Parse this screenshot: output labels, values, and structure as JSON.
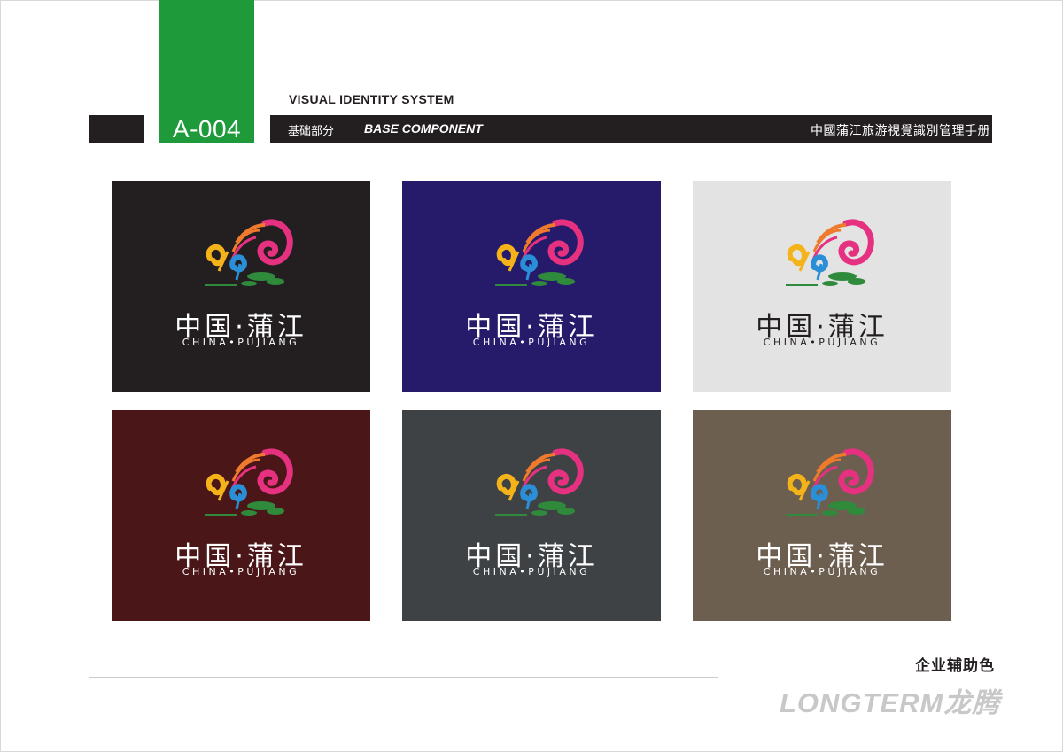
{
  "header": {
    "code": "A-004",
    "visual_identity": "VISUAL IDENTITY SYSTEM",
    "base_cn": "基础部分",
    "base_en": "BASE COMPONENT",
    "manual_title": "中國蒲江旅游視覺識別管理手册"
  },
  "logo": {
    "cn": "中国·蒲江",
    "en": "CHINA•PUJIANG"
  },
  "swatches": [
    {
      "background": "#231f20",
      "text_color": "#ffffff"
    },
    {
      "background": "#261a6b",
      "text_color": "#ffffff"
    },
    {
      "background": "#e3e3e3",
      "text_color": "#231f20"
    },
    {
      "background": "#4a1617",
      "text_color": "#ffffff"
    },
    {
      "background": "#3f4245",
      "text_color": "#ffffff"
    },
    {
      "background": "#6d5f4f",
      "text_color": "#ffffff"
    }
  ],
  "caption": "企业辅助色",
  "footer": {
    "brand": "LONGTERM龙腾"
  },
  "colors": {
    "accent_green": "#1e9a3a",
    "bar_dark": "#231f20",
    "logo_pink": "#e5317f",
    "logo_yellow": "#f5b31a",
    "logo_blue": "#2a8fd6",
    "logo_green": "#2f8a3c",
    "logo_orange": "#f07a2c",
    "brand_red": "#d8262e"
  }
}
